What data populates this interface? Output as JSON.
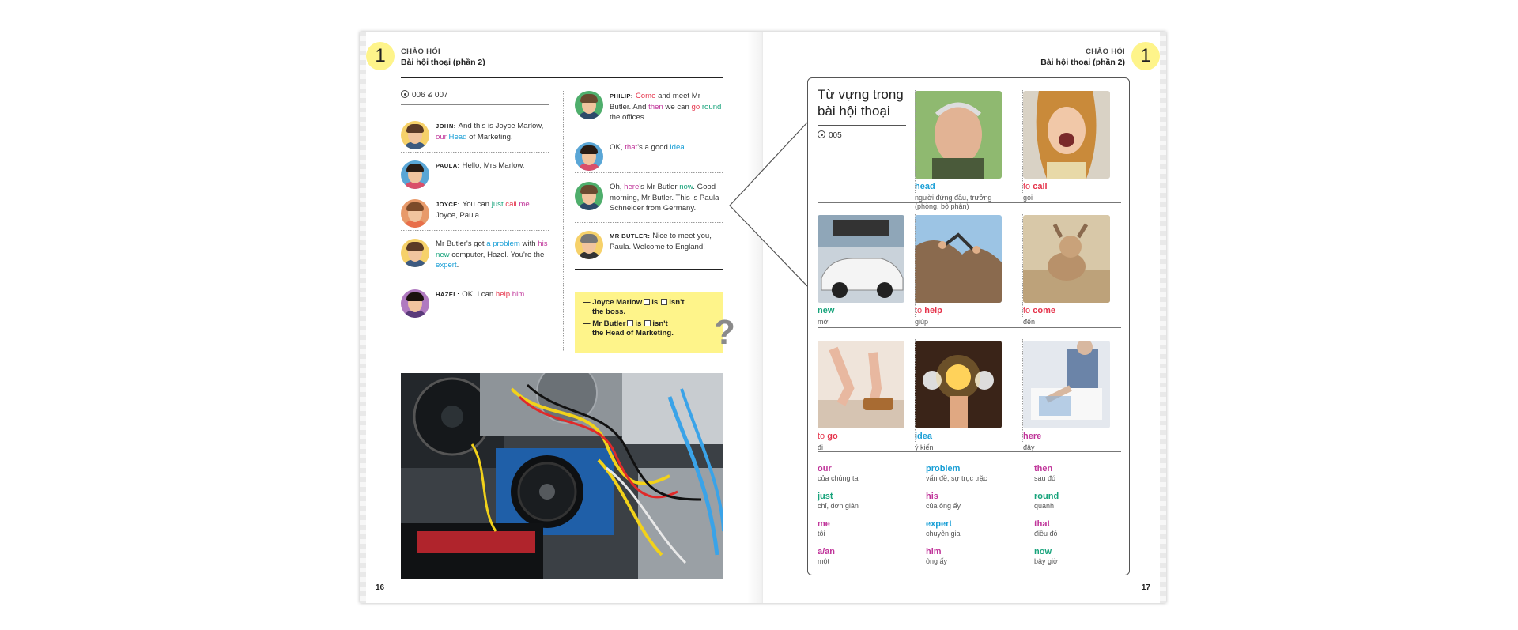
{
  "left_page": {
    "chapter_number": "1",
    "section_small": "CHÀO HỎI",
    "section_title": "Bài hội thoại (phần 2)",
    "audio_ref": "006 & 007",
    "page_number": "16",
    "dialogue_col1": [
      {
        "speaker": "JOHN:",
        "parts": [
          "And this is Joyce Marlow, ",
          "our",
          " ",
          "Head",
          " of Marketing."
        ]
      },
      {
        "speaker": "PAULA:",
        "parts": [
          "Hello, Mrs Marlow."
        ]
      },
      {
        "speaker": "JOYCE:",
        "parts": [
          "You can ",
          "just",
          " ",
          "call",
          " ",
          "me",
          " Joyce, Paula."
        ]
      },
      {
        "speaker": "",
        "parts": [
          "Mr Butler's got ",
          "a problem",
          " with ",
          "his",
          " ",
          "new",
          " computer, Hazel. You're the ",
          "expert",
          "."
        ]
      },
      {
        "speaker": "HAZEL:",
        "parts": [
          "OK, I can ",
          "help",
          " ",
          "him",
          "."
        ]
      }
    ],
    "dialogue_col2": [
      {
        "speaker": "PHILIP:",
        "parts": [
          "Come",
          " and meet Mr Butler. And ",
          "then",
          " we can ",
          "go",
          " ",
          "round",
          " the offices."
        ]
      },
      {
        "speaker": "",
        "parts": [
          "OK, ",
          "that",
          "'s a good ",
          "idea",
          "."
        ]
      },
      {
        "speaker": "",
        "parts": [
          "Oh, ",
          "here",
          "'s Mr Butler ",
          "now",
          ". Good morning, Mr Butler. This is Paula Schneider from Germany."
        ]
      },
      {
        "speaker": "MR BUTLER:",
        "parts": [
          "Nice to meet you, Paula. Welcome to England!"
        ]
      }
    ],
    "quiz": [
      {
        "pre": "— Joyce Marlow",
        "mid": "is",
        "post": "isn't",
        "line2": "the boss."
      },
      {
        "pre": "— Mr Butler",
        "mid": "is",
        "post": "isn't",
        "line2": "the Head of Marketing."
      }
    ],
    "quiz_mark": "?"
  },
  "right_page": {
    "chapter_number": "1",
    "section_small": "CHÀO HỎI",
    "section_title": "Bài hội thoại (phần 2)",
    "page_number": "17",
    "vocab_title_line1": "Từ vựng trong",
    "vocab_title_line2": "bài hội thoại",
    "audio_ref": "005",
    "picture_words": [
      {
        "pre": "",
        "word": "head",
        "color": "#1a9fd6",
        "trans": "người đứng đầu, trưởng (phòng, bộ phận)"
      },
      {
        "pre": "to ",
        "word": "call",
        "color": "#e5344b",
        "trans": "gọi"
      },
      {
        "pre": "",
        "word": "new",
        "color": "#17a37b",
        "trans": "mới"
      },
      {
        "pre": "to ",
        "word": "help",
        "color": "#e5344b",
        "trans": "giúp"
      },
      {
        "pre": "to ",
        "word": "come",
        "color": "#e5344b",
        "trans": "đến"
      },
      {
        "pre": "to ",
        "word": "go",
        "color": "#e5344b",
        "trans": "đi"
      },
      {
        "pre": "",
        "word": "idea",
        "color": "#1a9fd6",
        "trans": "ý kiến"
      },
      {
        "pre": "",
        "word": "here",
        "color": "#c0359a",
        "trans": "đây"
      }
    ],
    "word_list": [
      {
        "word": "our",
        "color": "#c0359a",
        "trans": "của chúng ta"
      },
      {
        "word": "just",
        "color": "#17a37b",
        "trans": "chỉ, đơn giản"
      },
      {
        "word": "me",
        "color": "#c0359a",
        "trans": "tôi"
      },
      {
        "word": "a/an",
        "color": "#c0359a",
        "trans": "một"
      },
      {
        "word": "problem",
        "color": "#1a9fd6",
        "trans": "vấn đề, sự trục trặc"
      },
      {
        "word": "his",
        "color": "#c0359a",
        "trans": "của ông ấy"
      },
      {
        "word": "expert",
        "color": "#1a9fd6",
        "trans": "chuyên gia"
      },
      {
        "word": "him",
        "color": "#c0359a",
        "trans": "ông ấy"
      },
      {
        "word": "then",
        "color": "#c0359a",
        "trans": "sau đó"
      },
      {
        "word": "round",
        "color": "#17a37b",
        "trans": "quanh"
      },
      {
        "word": "that",
        "color": "#c0359a",
        "trans": "điều đó"
      },
      {
        "word": "now",
        "color": "#17a37b",
        "trans": "bây giờ"
      }
    ]
  },
  "colors": {
    "red": "#e5344b",
    "blue": "#1a9fd6",
    "green": "#17a37b",
    "magenta": "#c0359a",
    "yellow": "#fef48a"
  }
}
